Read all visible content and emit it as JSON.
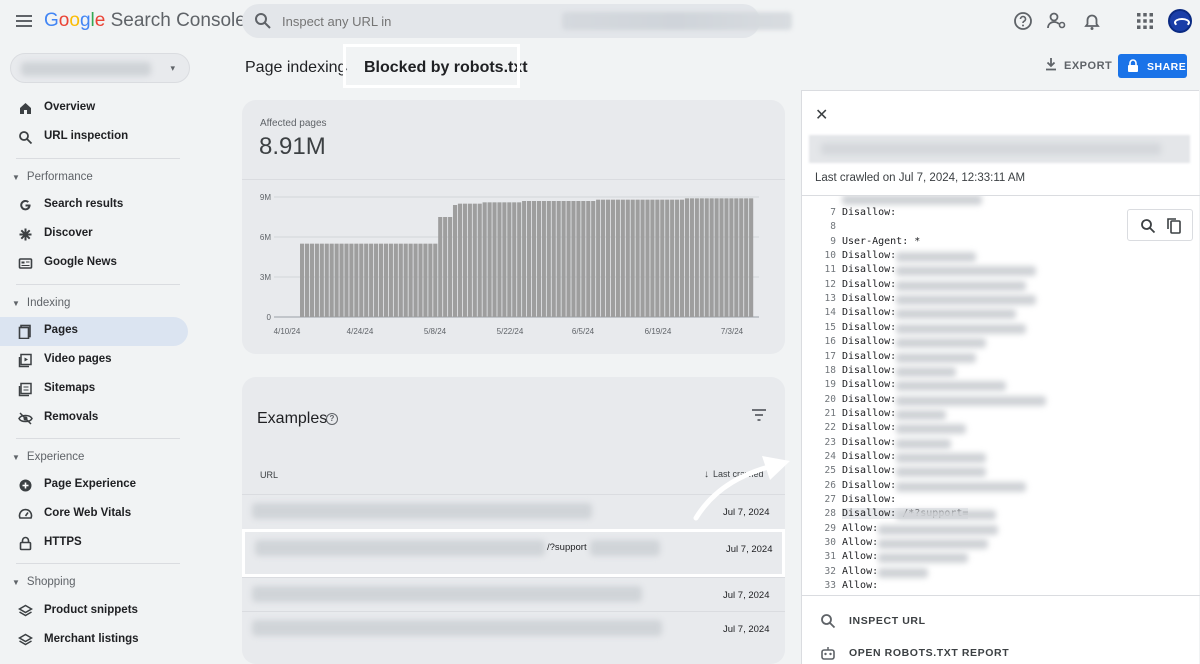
{
  "app": {
    "logo_parts": [
      "G",
      "o",
      "o",
      "g",
      "l",
      "e"
    ],
    "product": "Search Console",
    "search_placeholder": "Inspect any URL in"
  },
  "sidebar": {
    "items": [
      {
        "label": "Overview",
        "icon": "home-icon"
      },
      {
        "label": "URL inspection",
        "icon": "search-icon"
      }
    ],
    "sections": [
      {
        "title": "Performance",
        "items": [
          {
            "label": "Search results",
            "icon": "google-g-icon"
          },
          {
            "label": "Discover",
            "icon": "asterisk-icon"
          },
          {
            "label": "Google News",
            "icon": "news-icon"
          }
        ]
      },
      {
        "title": "Indexing",
        "items": [
          {
            "label": "Pages",
            "icon": "pages-icon",
            "active": true
          },
          {
            "label": "Video pages",
            "icon": "video-pages-icon"
          },
          {
            "label": "Sitemaps",
            "icon": "sitemaps-icon"
          },
          {
            "label": "Removals",
            "icon": "removals-icon"
          }
        ]
      },
      {
        "title": "Experience",
        "items": [
          {
            "label": "Page Experience",
            "icon": "plus-circle-icon"
          },
          {
            "label": "Core Web Vitals",
            "icon": "gauge-icon"
          },
          {
            "label": "HTTPS",
            "icon": "lock-icon"
          }
        ]
      },
      {
        "title": "Shopping",
        "items": [
          {
            "label": "Product snippets",
            "icon": "layers-icon"
          },
          {
            "label": "Merchant listings",
            "icon": "layers-icon"
          }
        ]
      }
    ]
  },
  "breadcrumb": {
    "parent": "Page indexing",
    "current": "Blocked by robots.txt"
  },
  "header_actions": {
    "export": "EXPORT",
    "share": "SHARE"
  },
  "summary": {
    "affected_label": "Affected pages",
    "affected_value": "8.91M"
  },
  "chart_data": {
    "type": "bar",
    "y_ticks": [
      "9M",
      "6M",
      "3M",
      "0"
    ],
    "ylim": [
      0,
      9000000
    ],
    "x_ticks": [
      "4/10/24",
      "4/24/24",
      "5/8/24",
      "5/22/24",
      "6/5/24",
      "6/19/24",
      "7/3/24"
    ],
    "values": [
      5.5,
      5.5,
      5.5,
      5.5,
      5.5,
      5.5,
      5.5,
      5.5,
      5.5,
      5.5,
      5.5,
      5.5,
      5.5,
      5.5,
      5.5,
      5.5,
      5.5,
      5.5,
      5.5,
      5.5,
      5.5,
      5.5,
      5.5,
      5.5,
      5.5,
      5.5,
      5.5,
      5.5,
      7.5,
      7.5,
      7.5,
      8.4,
      8.5,
      8.5,
      8.5,
      8.5,
      8.5,
      8.6,
      8.6,
      8.6,
      8.6,
      8.6,
      8.6,
      8.6,
      8.6,
      8.7,
      8.7,
      8.7,
      8.7,
      8.7,
      8.7,
      8.7,
      8.7,
      8.7,
      8.7,
      8.7,
      8.7,
      8.7,
      8.7,
      8.7,
      8.8,
      8.8,
      8.8,
      8.8,
      8.8,
      8.8,
      8.8,
      8.8,
      8.8,
      8.8,
      8.8,
      8.8,
      8.8,
      8.8,
      8.8,
      8.8,
      8.8,
      8.8,
      8.9,
      8.9,
      8.9,
      8.9,
      8.9,
      8.9,
      8.9,
      8.9,
      8.9,
      8.9,
      8.9,
      8.9,
      8.9,
      8.9
    ],
    "value_unit": "millions of pages",
    "grid": true,
    "bar_color": "#9e9e9e"
  },
  "examples": {
    "title": "Examples",
    "col_url": "URL",
    "col_last": "Last crawled",
    "rows": [
      {
        "url_visible": "",
        "date": "Jul 7, 2024"
      },
      {
        "url_visible": "/?support",
        "date": "Jul 7, 2024",
        "selected": true
      },
      {
        "url_visible": "",
        "date": "Jul 7, 2024"
      },
      {
        "url_visible": "",
        "date": "Jul 7, 2024"
      }
    ]
  },
  "panel": {
    "last_crawled": "Last crawled on Jul 7, 2024, 12:33:11 AM",
    "code_lines": [
      {
        "n": "7",
        "text": "Disallow:"
      },
      {
        "n": "8",
        "text": ""
      },
      {
        "n": "9",
        "text": "User-Agent: *"
      },
      {
        "n": "10",
        "text": "Disallow:"
      },
      {
        "n": "11",
        "text": "Disallow:"
      },
      {
        "n": "12",
        "text": "Disallow:"
      },
      {
        "n": "13",
        "text": "Disallow:"
      },
      {
        "n": "14",
        "text": "Disallow:"
      },
      {
        "n": "15",
        "text": "Disallow:"
      },
      {
        "n": "16",
        "text": "Disallow:"
      },
      {
        "n": "17",
        "text": "Disallow:"
      },
      {
        "n": "18",
        "text": "Disallow:"
      },
      {
        "n": "19",
        "text": "Disallow:"
      },
      {
        "n": "20",
        "text": "Disallow:"
      },
      {
        "n": "21",
        "text": "Disallow:"
      },
      {
        "n": "22",
        "text": "Disallow:"
      },
      {
        "n": "23",
        "text": "Disallow:"
      },
      {
        "n": "24",
        "text": "Disallow:"
      },
      {
        "n": "25",
        "text": "Disallow:"
      },
      {
        "n": "26",
        "text": "Disallow:"
      },
      {
        "n": "27",
        "text": "Disallow:"
      },
      {
        "n": "28",
        "text": "Disallow: /*?support=",
        "highlight": true
      },
      {
        "n": "29",
        "text": "Allow:"
      },
      {
        "n": "30",
        "text": "Allow:"
      },
      {
        "n": "31",
        "text": "Allow:"
      },
      {
        "n": "32",
        "text": "Allow:"
      },
      {
        "n": "33",
        "text": "Allow:"
      }
    ],
    "actions": {
      "inspect": "INSPECT URL",
      "open_report": "OPEN ROBOTS.TXT REPORT"
    }
  }
}
